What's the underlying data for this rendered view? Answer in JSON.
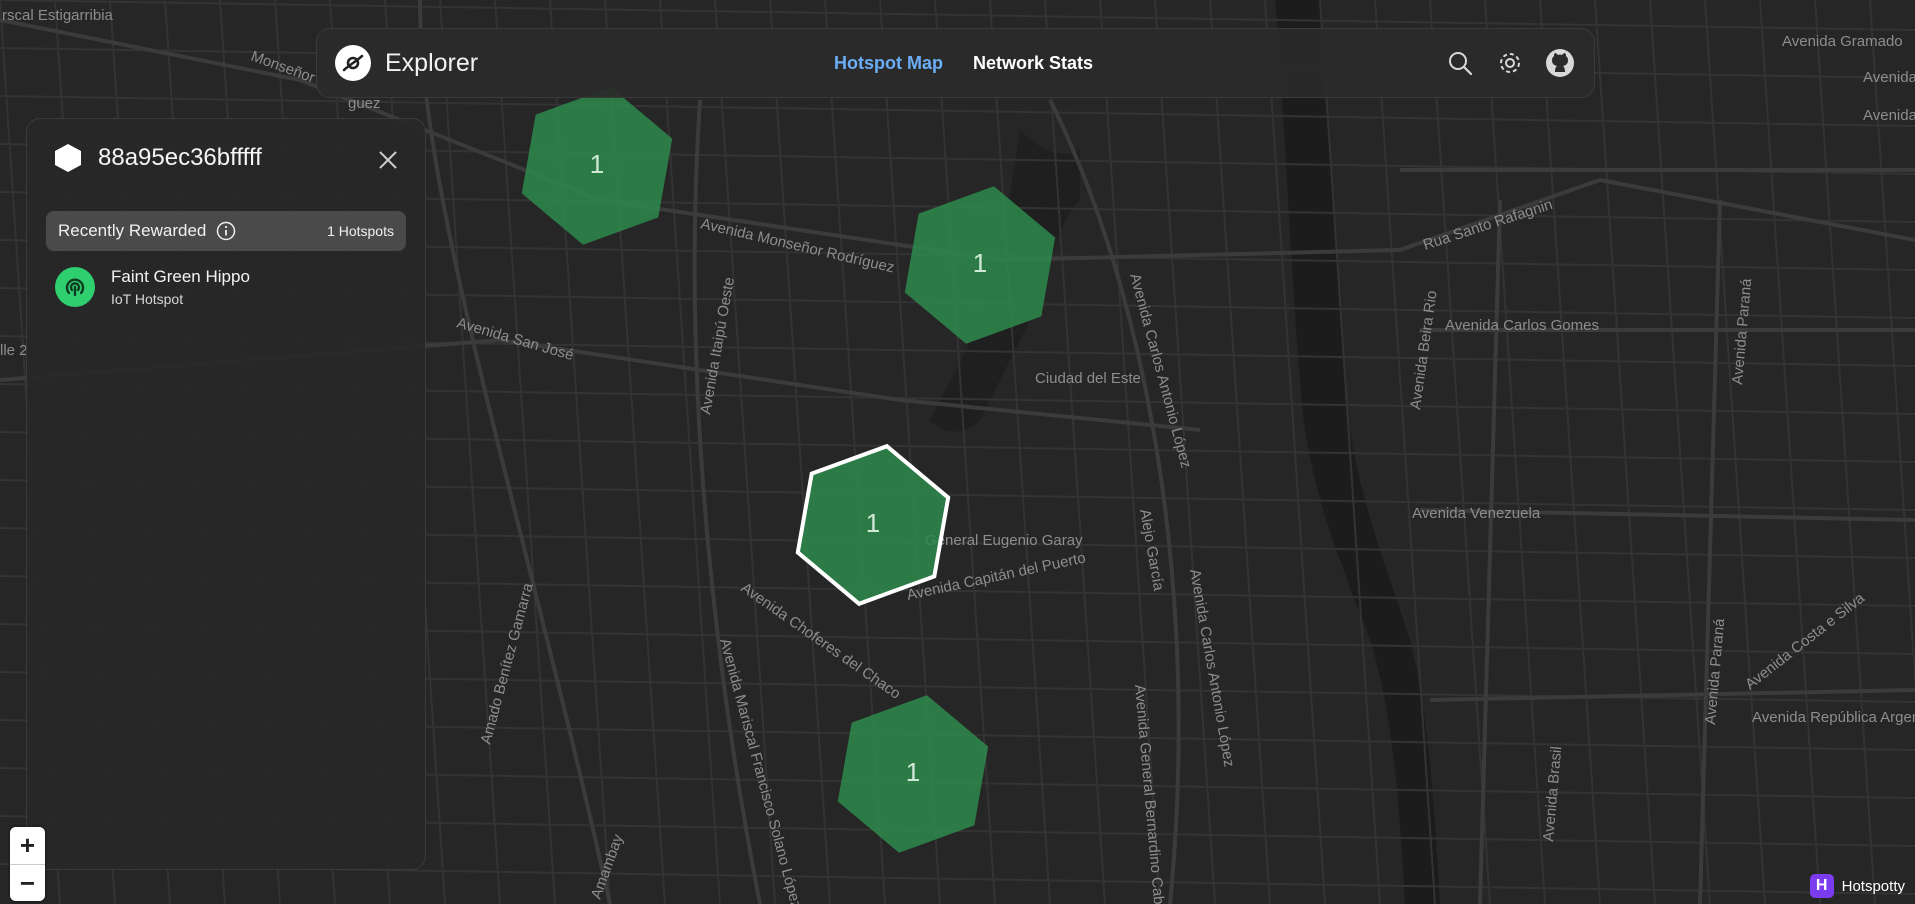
{
  "app": {
    "title": "Explorer",
    "logo_icon": "helium-logo-icon"
  },
  "nav": {
    "items": [
      {
        "label": "Hotspot Map",
        "active": true
      },
      {
        "label": "Network Stats",
        "active": false
      }
    ],
    "icons": [
      "search-icon",
      "gear-icon",
      "github-icon"
    ]
  },
  "panel": {
    "hex_id": "88a95ec36bfffff",
    "section": {
      "label": "Recently Rewarded",
      "count_label": "1 Hotspots"
    },
    "hotspots": [
      {
        "name": "Faint Green Hippo",
        "type": "IoT Hotspot",
        "icon": "antenna-icon"
      }
    ]
  },
  "map": {
    "hex_color": "#2e8b4e",
    "hex_selected_border": "#ffffff",
    "hexes": [
      {
        "count": "1",
        "selected": false
      },
      {
        "count": "1",
        "selected": false
      },
      {
        "count": "1",
        "selected": true
      },
      {
        "count": "1",
        "selected": false
      }
    ],
    "street_labels": [
      "rscal Estigarribia",
      "Monseñor",
      "guez",
      "Avenida Monseñor Rodríguez",
      "Avenida San José",
      "Avenida Itaipú Oeste",
      "Avenida Carlos Antonio López",
      "Ciudad del Este",
      "General Eugenio Garay",
      "Avenida Capitán del Puerto",
      "Avenida Choferes del Chaco",
      "Amado Benítez Gamarra",
      "Avenida Mariscal Francisco Solano López",
      "Amambay",
      "Alejo García",
      "Avenida Carlos Antonio López",
      "Avenida General Bernardino Caballero",
      "Rua Santo Rafagnin",
      "Avenida Beira Rio",
      "Avenida Carlos Gomes",
      "Avenida Paraná",
      "Avenida Venezuela",
      "Avenida Paraná",
      "Avenida Costa e Silva",
      "Avenida República Argentina",
      "Avenida Brasil",
      "Avenida Gramado",
      "Avenida",
      "Avenida",
      "lle 2"
    ]
  },
  "zoom": {
    "in_label": "+",
    "out_label": "−"
  },
  "attribution": {
    "logo_letter": "H",
    "text": "Hotspotty"
  }
}
